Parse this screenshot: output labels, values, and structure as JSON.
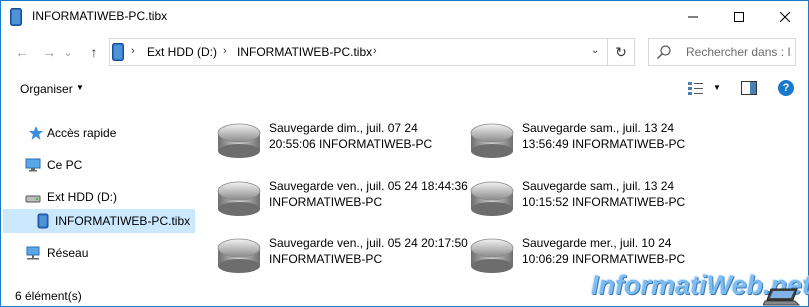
{
  "window": {
    "title": "INFORMATIWEB-PC.tibx",
    "minimize_glyph": "—",
    "maximize_glyph": "☐",
    "close_glyph": "✕"
  },
  "nav": {
    "back_glyph": "←",
    "forward_glyph": "→",
    "recent_glyph": "⌄",
    "up_glyph": "↑"
  },
  "address": {
    "crumbs": [
      "Ext HDD (D:)",
      "INFORMATIWEB-PC.tibx"
    ],
    "separator": "›",
    "refresh_glyph": "↻"
  },
  "search": {
    "placeholder": "Rechercher dans : I..."
  },
  "toolbar": {
    "organize_label": "Organiser",
    "caret": "▼",
    "help_glyph": "?"
  },
  "sidebar": {
    "items": [
      {
        "label": "Accès rapide",
        "icon": "star-icon"
      },
      {
        "label": "Ce PC",
        "icon": "computer-icon"
      },
      {
        "label": "Ext HDD (D:)",
        "icon": "drive-icon"
      },
      {
        "label": "INFORMATIWEB-PC.tibx",
        "icon": "backup-file-icon",
        "selected": true
      },
      {
        "label": "Réseau",
        "icon": "network-icon"
      }
    ]
  },
  "files": [
    {
      "line1": "Sauvegarde dim., juil. 07 24",
      "line2": "20:55:06 INFORMATIWEB-PC"
    },
    {
      "line1": "Sauvegarde sam., juil. 13 24",
      "line2": "13:56:49 INFORMATIWEB-PC"
    },
    {
      "line1": "Sauvegarde ven., juil. 05 24 18:44:36",
      "line2": "INFORMATIWEB-PC"
    },
    {
      "line1": "Sauvegarde sam., juil. 13 24",
      "line2": "10:15:52 INFORMATIWEB-PC"
    },
    {
      "line1": "Sauvegarde ven., juil. 05 24 20:17:50",
      "line2": "INFORMATIWEB-PC"
    },
    {
      "line1": "Sauvegarde mer., juil. 10 24",
      "line2": "10:06:29 INFORMATIWEB-PC"
    }
  ],
  "status": {
    "count_text": "6 élément(s)"
  },
  "watermark": {
    "text": "InformatiWeb.net"
  },
  "colors": {
    "accent": "#1979ca",
    "selection": "#cce8ff",
    "disk_light": "#e8e8e8",
    "disk_dark": "#7a7a7a"
  }
}
